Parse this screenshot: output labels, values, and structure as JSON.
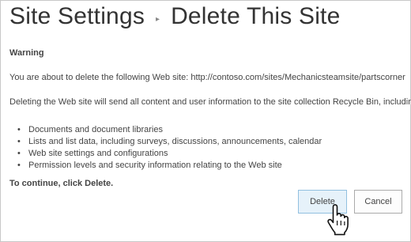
{
  "breadcrumb": {
    "parent": "Site Settings",
    "current": "Delete This Site",
    "separator": "›"
  },
  "warning": {
    "heading": "Warning",
    "line1_prefix": "You are about to delete the following Web site: ",
    "site_url": "http://contoso.com/sites/Mechanicsteamsite/partscorner",
    "description": "Deleting the Web site will send all content and user information to the site collection Recycle Bin, including:",
    "items": [
      "Documents and document libraries",
      "Lists and list data, including surveys, discussions, announcements, calendar",
      "Web site settings and configurations",
      "Permission levels and security information relating to the Web site"
    ],
    "continue_text": "To continue, click Delete."
  },
  "buttons": {
    "delete_label": "Delete",
    "cancel_label": "Cancel"
  },
  "cursor_icon": "hand-pointer-icon",
  "colors": {
    "delete_button_bg": "#e6f2fa",
    "delete_button_border": "#92c0e0"
  }
}
